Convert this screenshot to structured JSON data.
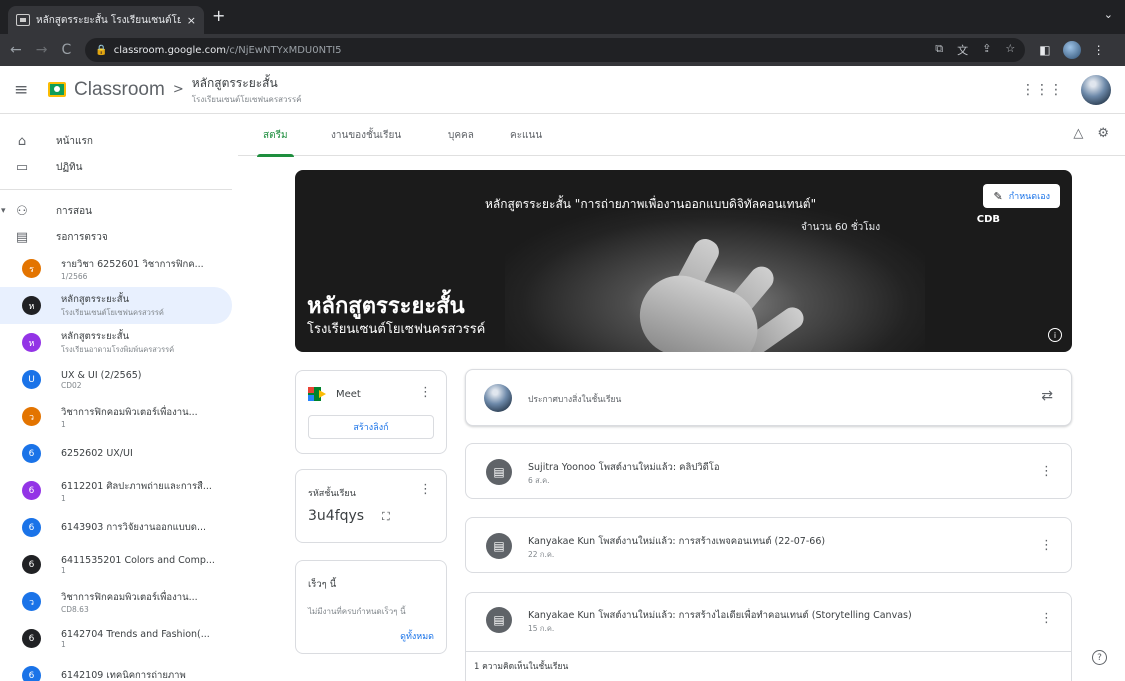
{
  "browser": {
    "tab_title": "หลักสูตรระยะสั้น โรงเรียนเซนต์โย...",
    "tab_close": "×",
    "new_tab": "+",
    "url_host": "classroom.google.com",
    "url_path": "/c/NjEwNTYxMDU0NTI5"
  },
  "header": {
    "brand": "Classroom",
    "crumb_sep": ">",
    "class_title": "หลักสูตรระยะสั้น",
    "class_subtitle": "โรงเรียนเซนต์โยเซฟนครสวรรค์"
  },
  "sidebar": {
    "nav": [
      {
        "label": "หน้าแรก",
        "icon": "home-icon",
        "glyph": "⌂"
      },
      {
        "label": "ปฏิทิน",
        "icon": "calendar-icon",
        "glyph": "▭"
      }
    ],
    "teaching": {
      "label": "การสอน",
      "icon": "people-icon",
      "glyph": "👥"
    },
    "review": {
      "label": "รอการตรวจ",
      "icon": "folder-icon",
      "glyph": "▤"
    },
    "classes": [
      {
        "initial": "ร",
        "name": "รายวิชา 6252601 วิชาการฟิกค...",
        "sub": "1/2566",
        "color": "#e37400"
      },
      {
        "initial": "ห",
        "name": "หลักสูตรระยะสั้น",
        "sub": "โรงเรียนเซนต์โยเซฟนครสวรรค์",
        "color": "#202124",
        "active": true
      },
      {
        "initial": "ห",
        "name": "หลักสูตรระยะสั้น",
        "sub": "โรงเรียนอาดามโรงพิมพ์นครสวรรค์",
        "color": "#9334e6"
      },
      {
        "initial": "U",
        "name": "UX & UI (2/2565)",
        "sub": "CD02",
        "color": "#1a73e8"
      },
      {
        "initial": "ว",
        "name": "วิชาการฟิกคอมพิวเตอร์เพื่องาน...",
        "sub": "1",
        "color": "#e37400"
      },
      {
        "initial": "6",
        "name": "6252602 UX/UI",
        "sub": "",
        "color": "#1a73e8"
      },
      {
        "initial": "6",
        "name": "6112201 ศิลปะภาพถ่ายและการสื...",
        "sub": "1",
        "color": "#9334e6"
      },
      {
        "initial": "6",
        "name": "6143903 การวิจัยงานออกแบบด...",
        "sub": "",
        "color": "#1a73e8"
      },
      {
        "initial": "6",
        "name": "6411535201 Colors and Comp...",
        "sub": "1",
        "color": "#202124"
      },
      {
        "initial": "ว",
        "name": "วิชาการฟิกคอมพิวเตอร์เพื่องาน...",
        "sub": "CD8.63",
        "color": "#1a73e8"
      },
      {
        "initial": "6",
        "name": "6142704 Trends and Fashion(...",
        "sub": "1",
        "color": "#202124"
      },
      {
        "initial": "6",
        "name": "6142109 เทคนิคการถ่ายภาพ",
        "sub": "",
        "color": "#1a73e8"
      }
    ]
  },
  "tabs": [
    {
      "label": "สตรีม",
      "active": true
    },
    {
      "label": "งานของชั้นเรียน",
      "active": false
    },
    {
      "label": "บุคคล",
      "active": false
    },
    {
      "label": "คะแนน",
      "active": false
    }
  ],
  "banner": {
    "top_line": "หลักสูตรระยะสั้น \"การถ่ายภาพเพื่องานออกแบบดิจิทัลคอนเทนต์\"",
    "hours": "จำนวน 60 ชั่วโมง",
    "title": "หลักสูตรระยะสั้น",
    "subtitle": "โรงเรียนเซนต์โยเซฟนครสวรรค์",
    "customize_label": "กำหนดเอง",
    "cdb": "CDB"
  },
  "meet": {
    "label": "Meet",
    "generate_link": "สร้างลิงก์"
  },
  "class_code": {
    "label": "รหัสชั้นเรียน",
    "code": "3u4fqys"
  },
  "upcoming": {
    "title": "เร็วๆ นี้",
    "empty_text": "ไม่มีงานที่ครบกำหนดเร็วๆ นี้",
    "view_all": "ดูทั้งหมด"
  },
  "announce": {
    "placeholder": "ประกาศบางสิ่งในชั้นเรียน"
  },
  "posts": [
    {
      "text": "Sujitra Yoonoo โพสต์งานใหม่แล้ว: คลิปวิดีโอ",
      "time": "6 ส.ค."
    },
    {
      "text": "Kanyakae Kun โพสต์งานใหม่แล้ว: การสร้างเพจคอนเทนต์ (22-07-66)",
      "time": "22 ก.ค."
    },
    {
      "text": "Kanyakae Kun โพสต์งานใหม่แล้ว: การสร้างไอเดียเพื่อทำคอนเทนต์ (Storytelling Canvas)",
      "time": "15 ก.ค."
    }
  ],
  "comments_label": "1 ความคิดเห็นในชั้นเรียน"
}
